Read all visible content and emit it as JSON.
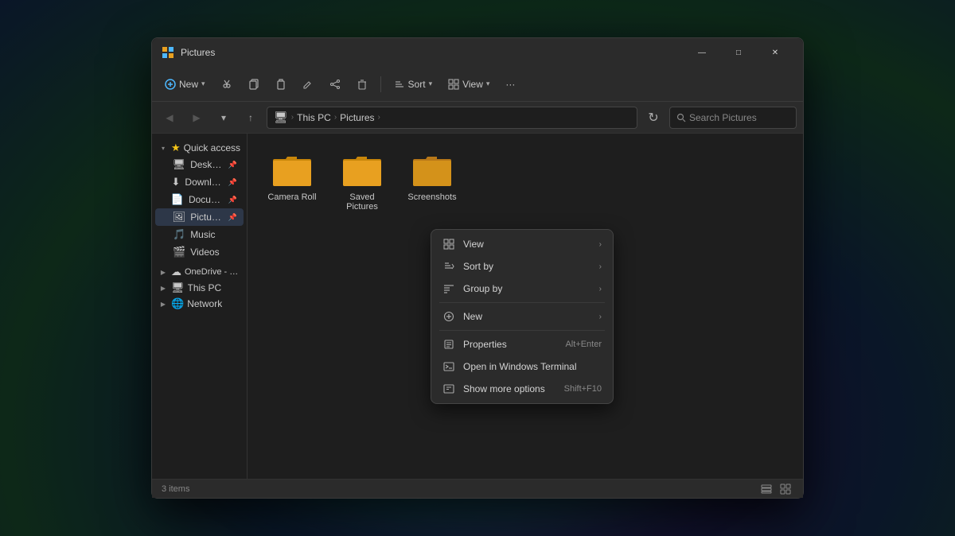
{
  "window": {
    "title": "Pictures",
    "controls": {
      "minimize": "—",
      "maximize": "□",
      "close": "✕"
    }
  },
  "toolbar": {
    "new_label": "New",
    "sort_label": "Sort",
    "view_label": "View",
    "more_label": "···"
  },
  "addressbar": {
    "back_disabled": true,
    "forward_disabled": true,
    "path": [
      {
        "label": "This PC",
        "icon": "pc"
      },
      {
        "label": "Pictures",
        "icon": "pictures"
      }
    ],
    "search_placeholder": "Search Pictures"
  },
  "sidebar": {
    "quick_access_label": "Quick access",
    "items": [
      {
        "label": "Desktop",
        "icon": "desktop",
        "pinned": true
      },
      {
        "label": "Downloads",
        "icon": "downloads",
        "pinned": true
      },
      {
        "label": "Documents",
        "icon": "documents",
        "pinned": true
      },
      {
        "label": "Pictures",
        "icon": "pictures",
        "pinned": true,
        "active": true
      },
      {
        "label": "Music",
        "icon": "music"
      },
      {
        "label": "Videos",
        "icon": "videos"
      }
    ],
    "sections": [
      {
        "label": "OneDrive - Personal",
        "icon": "onedrive",
        "expanded": false
      },
      {
        "label": "This PC",
        "icon": "pc",
        "expanded": false
      },
      {
        "label": "Network",
        "icon": "network",
        "expanded": false
      }
    ]
  },
  "files": [
    {
      "name": "Camera Roll",
      "type": "folder"
    },
    {
      "name": "Saved Pictures",
      "type": "folder"
    },
    {
      "name": "Screenshots",
      "type": "folder"
    }
  ],
  "context_menu": {
    "items": [
      {
        "label": "View",
        "icon": "grid-icon",
        "has_arrow": true
      },
      {
        "label": "Sort by",
        "icon": "sort-icon",
        "has_arrow": true
      },
      {
        "label": "Group by",
        "icon": "group-icon",
        "has_arrow": true
      },
      {
        "divider": true
      },
      {
        "label": "New",
        "icon": "new-icon",
        "has_arrow": true
      },
      {
        "divider": false
      },
      {
        "label": "Properties",
        "icon": "properties-icon",
        "shortcut": "Alt+Enter"
      },
      {
        "label": "Open in Windows Terminal",
        "icon": "terminal-icon"
      },
      {
        "label": "Show more options",
        "icon": "more-options-icon",
        "shortcut": "Shift+F10"
      }
    ]
  },
  "statusbar": {
    "count_label": "3 items",
    "view_icons": [
      "list-view-icon",
      "tile-view-icon"
    ]
  }
}
